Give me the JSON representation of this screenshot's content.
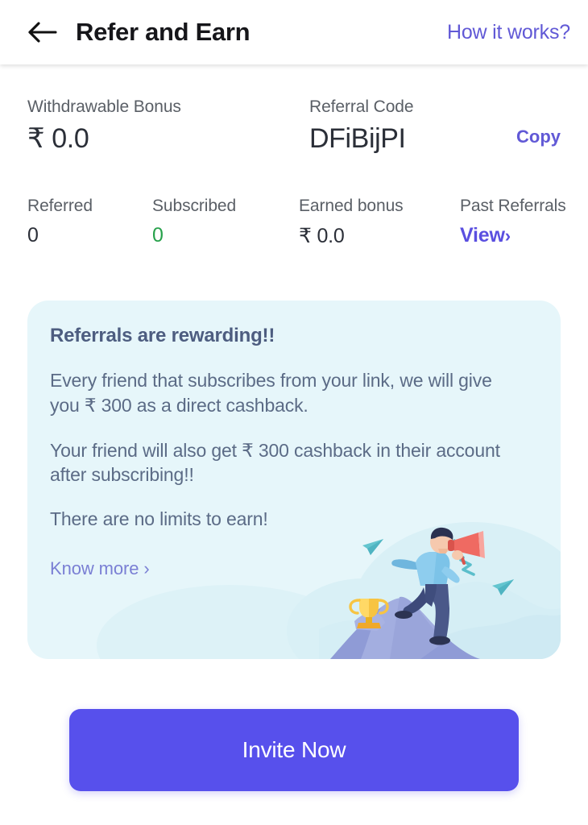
{
  "header": {
    "back_icon": "arrow-left-icon",
    "title": "Refer and Earn",
    "action_label": "How it works?"
  },
  "summary": {
    "bonus_label": "Withdrawable Bonus",
    "bonus_value": "₹ 0.0",
    "code_label": "Referral Code",
    "code_value": "DFiBijPI",
    "copy_label": "Copy"
  },
  "stats": {
    "referred_label": "Referred",
    "referred_value": "0",
    "subscribed_label": "Subscribed",
    "subscribed_value": "0",
    "earned_label": "Earned bonus",
    "earned_value": "₹ 0.0",
    "past_label": "Past Referrals",
    "past_value": "View",
    "past_chevron": "›"
  },
  "card": {
    "title": "Referrals are rewarding!!",
    "para1": "Every friend that subscribes from your link, we will give you ₹ 300 as a direct cashback.",
    "para2": "Your friend will also get ₹ 300 cashback in their account after subscribing!!",
    "para3": "There are no limits to earn!",
    "know_more": "Know more ›",
    "illustration": "man-with-megaphone-on-mountain-illustration"
  },
  "cta": {
    "label": "Invite Now"
  },
  "colors": {
    "accent_purple": "#6159d6",
    "cta_blue": "#5750ec",
    "success_green": "#27a14b",
    "card_bg": "#e6f6fa",
    "card_text": "#5b6b86"
  }
}
